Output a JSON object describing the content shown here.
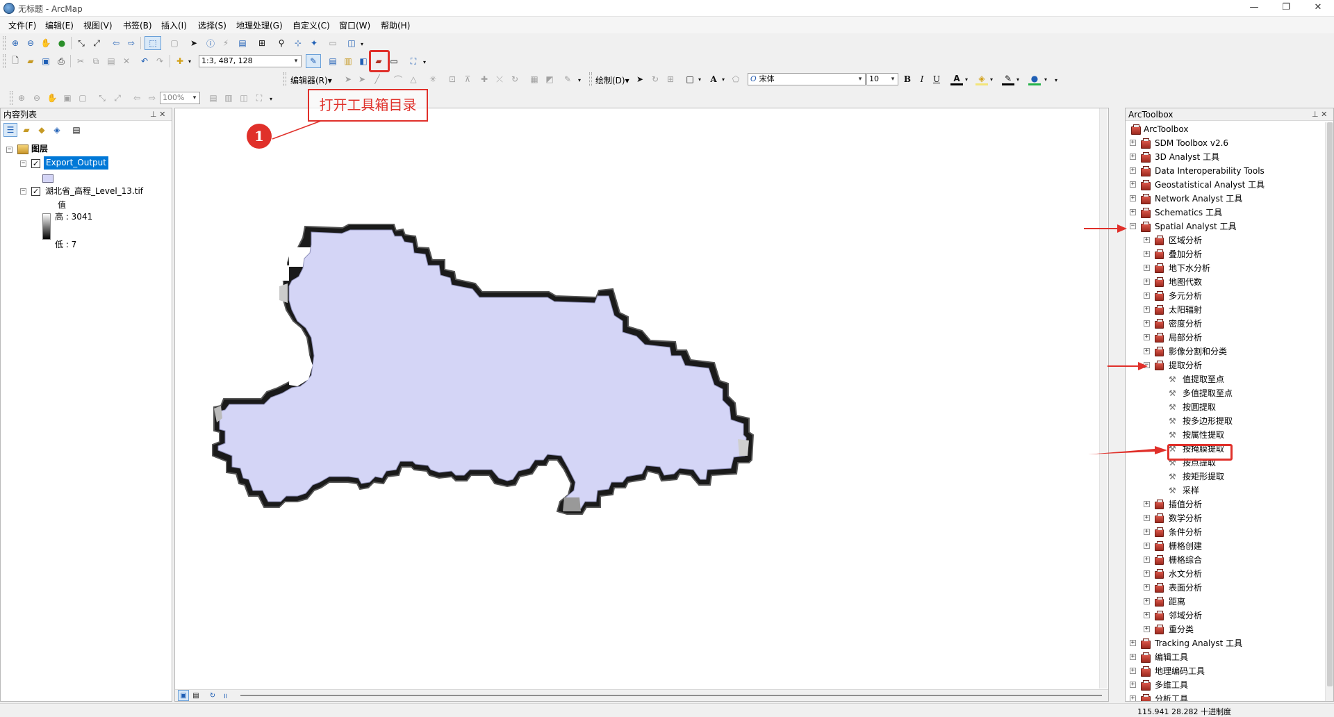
{
  "window": {
    "title": "无标题 - ArcMap",
    "minimize": "—",
    "restore": "❐",
    "close": "✕"
  },
  "menu": [
    "文件(F)",
    "编辑(E)",
    "视图(V)",
    "书签(B)",
    "插入(I)",
    "选择(S)",
    "地理处理(G)",
    "自定义(C)",
    "窗口(W)",
    "帮助(H)"
  ],
  "standard_toolbar": {
    "scale_value": "1:3, 487, 128"
  },
  "editor_toolbar": {
    "editor_label": "编辑器(R)▾"
  },
  "draw_toolbar": {
    "draw_label": "绘制(D)▾",
    "font_name": "宋体",
    "font_size": "10",
    "bold": "B",
    "italic": "I",
    "underline": "U",
    "text_tool": "A"
  },
  "layout_toolbar": {
    "zoom_value": "100%"
  },
  "callout": {
    "text": "打开工具箱目录",
    "number": "1"
  },
  "toc": {
    "title": "内容列表",
    "pin": "⊥ ✕",
    "root_label": "图层",
    "layer1": "Export_Output",
    "layer2": "湖北省_高程_Level_13.tif",
    "value_label": "值",
    "high_label": "高 : 3041",
    "low_label": "低 : 7"
  },
  "toolbox": {
    "title": "ArcToolbox",
    "pin": "⊥ ✕",
    "root": "ArcToolbox",
    "top_items": [
      "SDM Toolbox v2.6",
      "3D Analyst 工具",
      "Data Interoperability Tools",
      "Geostatistical Analyst 工具",
      "Network Analyst 工具",
      "Schematics 工具",
      "Spatial Analyst 工具"
    ],
    "spatial_children": [
      "区域分析",
      "叠加分析",
      "地下水分析",
      "地图代数",
      "多元分析",
      "太阳辐射",
      "密度分析",
      "局部分析",
      "影像分割和分类",
      "提取分析"
    ],
    "extract_tools": [
      "值提取至点",
      "多值提取至点",
      "按圆提取",
      "按多边形提取",
      "按属性提取",
      "按掩膜提取",
      "按点提取",
      "按矩形提取",
      "采样"
    ],
    "more_children": [
      "插值分析",
      "数学分析",
      "条件分析",
      "栅格创建",
      "栅格综合",
      "水文分析",
      "表面分析",
      "距离",
      "邻域分析",
      "重分类"
    ],
    "bottom_items": [
      "Tracking Analyst 工具",
      "编辑工具",
      "地理编码工具",
      "多维工具",
      "分析工具"
    ]
  },
  "status": {
    "coords": "115.941  28.282 十进制度"
  },
  "colors": {
    "polygon_fill": "#d4d5f6",
    "annotation_red": "#e0302a",
    "selection_blue": "#0078d7"
  }
}
